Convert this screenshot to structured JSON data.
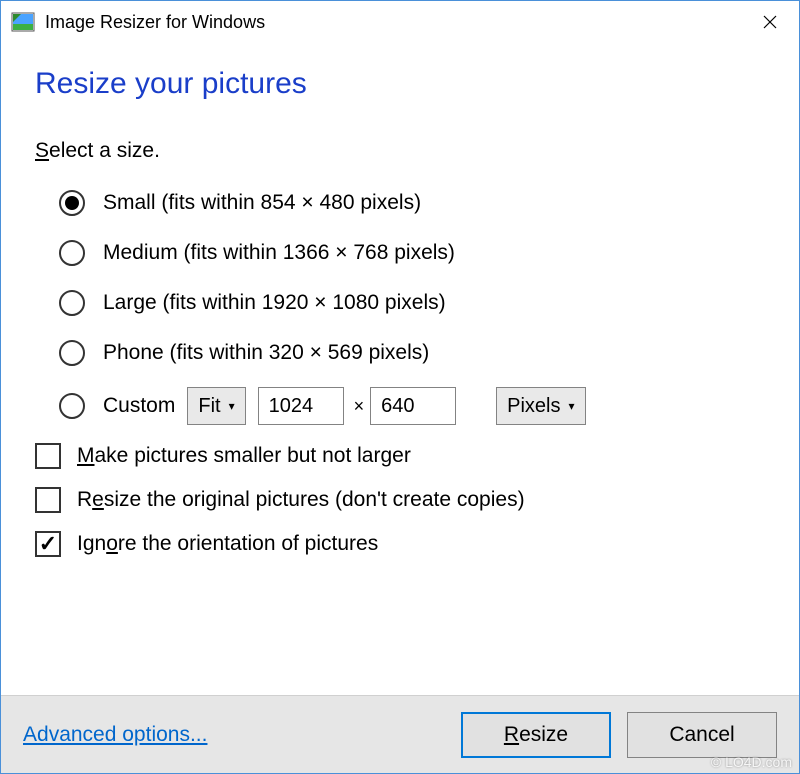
{
  "titlebar": {
    "title": "Image Resizer for Windows",
    "close_icon": "close"
  },
  "heading": "Resize your pictures",
  "select_label_pre": "S",
  "select_label_post": "elect a size.",
  "sizes": {
    "small": "Small (fits within 854 × 480 pixels)",
    "medium": "Medium (fits within 1366 × 768 pixels)",
    "large": "Large (fits within 1920 × 1080 pixels)",
    "phone": "Phone (fits within 320 × 569 pixels)",
    "custom_label": "Custom",
    "selected": "small"
  },
  "custom": {
    "mode": "Fit",
    "width": "1024",
    "height": "640",
    "times": "×",
    "unit": "Pixels"
  },
  "checks": {
    "smaller_pre": "M",
    "smaller_post": "ake pictures smaller but not larger",
    "smaller_checked": false,
    "resize_pre": "R",
    "resize_mid": "e",
    "resize_post": "size the original pictures (don't create copies)",
    "resize_checked": false,
    "ignore_pre": "Ign",
    "ignore_mid": "o",
    "ignore_post": "re the orientation of pictures",
    "ignore_checked": true
  },
  "footer": {
    "advanced_pre": "A",
    "advanced_post": "dvanced options...",
    "resize_pre": "R",
    "resize_post": "esize",
    "cancel": "Cancel"
  },
  "watermark": "© LO4D.com"
}
